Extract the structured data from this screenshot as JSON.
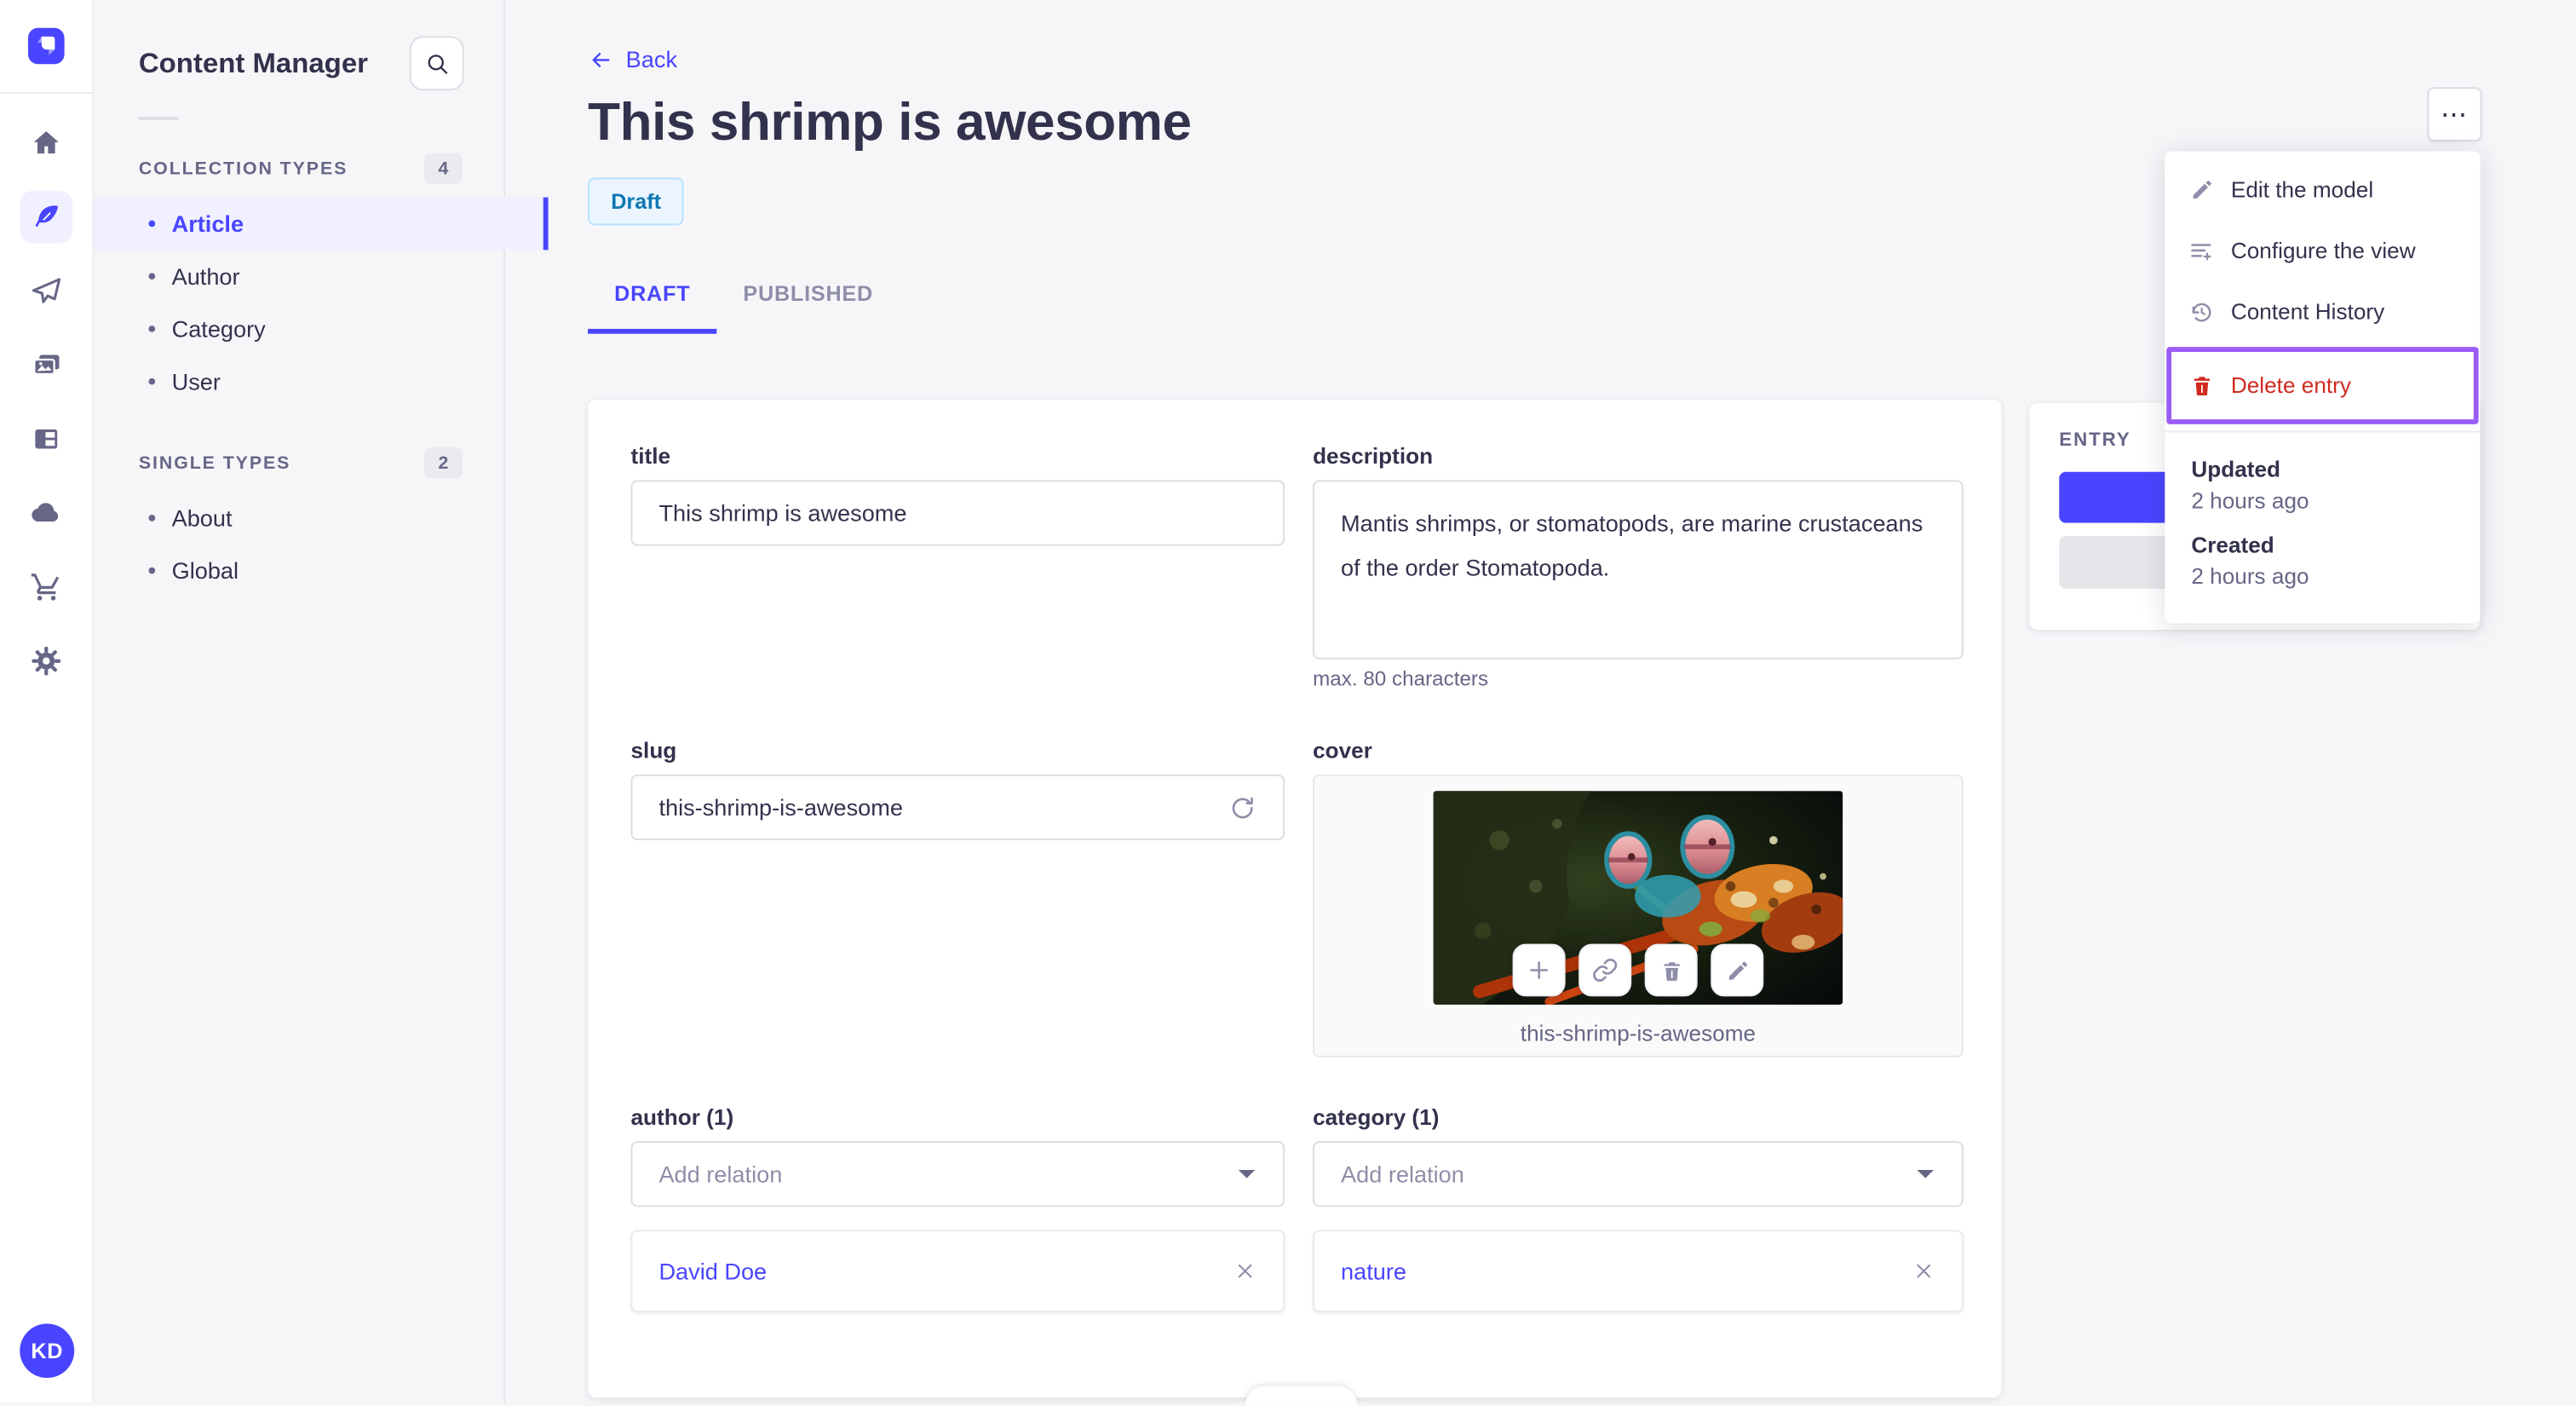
{
  "subnav": {
    "title": "Content Manager",
    "sections": [
      {
        "label": "COLLECTION TYPES",
        "count": "4",
        "items": [
          {
            "label": "Article",
            "active": true
          },
          {
            "label": "Author",
            "active": false
          },
          {
            "label": "Category",
            "active": false
          },
          {
            "label": "User",
            "active": false
          }
        ]
      },
      {
        "label": "SINGLE TYPES",
        "count": "2",
        "items": [
          {
            "label": "About",
            "active": false
          },
          {
            "label": "Global",
            "active": false
          }
        ]
      }
    ]
  },
  "rail": {
    "avatar_initials": "KD",
    "icons": [
      "home-icon",
      "feather-icon",
      "paper-plane-icon",
      "media-library-icon",
      "layout-icon",
      "cloud-icon",
      "cart-icon",
      "gear-icon"
    ]
  },
  "header": {
    "back_label": "Back",
    "title": "This shrimp is awesome",
    "status": "Draft",
    "tabs": [
      {
        "label": "DRAFT",
        "active": true
      },
      {
        "label": "PUBLISHED",
        "active": false
      }
    ],
    "more_label": "⋯"
  },
  "form": {
    "title": {
      "label": "title",
      "value": "This shrimp is awesome"
    },
    "description": {
      "label": "description",
      "value": "Mantis shrimps, or stomatopods, are marine crustaceans of the order Stomatopoda.",
      "hint": "max. 80 characters"
    },
    "slug": {
      "label": "slug",
      "value": "this-shrimp-is-awesome"
    },
    "cover": {
      "label": "cover",
      "caption": "this-shrimp-is-awesome"
    },
    "author": {
      "label": "author (1)",
      "placeholder": "Add relation",
      "relation": "David Doe"
    },
    "category": {
      "label": "category (1)",
      "placeholder": "Add relation",
      "relation": "nature"
    }
  },
  "entry_panel": {
    "title": "ENTRY"
  },
  "menu": {
    "items": [
      {
        "label": "Edit the model"
      },
      {
        "label": "Configure the view"
      },
      {
        "label": "Content History"
      },
      {
        "label": "Delete entry"
      }
    ],
    "meta": [
      {
        "label": "Updated",
        "value": "2 hours ago"
      },
      {
        "label": "Created",
        "value": "2 hours ago"
      }
    ]
  },
  "colors": {
    "accent": "#4945ff",
    "accent_light": "#f0f0ff",
    "danger": "#d02b20",
    "highlight_border": "#9b5cf6",
    "draft_bg": "#eaf5ff",
    "draft_border": "#b8e1ff",
    "draft_text": "#0e77b3",
    "text_dark": "#32324d",
    "text_gray": "#666687"
  }
}
